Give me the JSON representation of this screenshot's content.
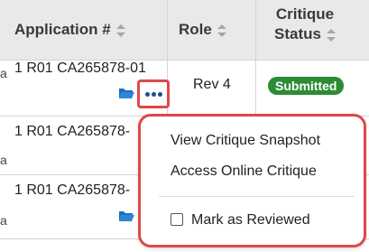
{
  "table": {
    "headers": {
      "application": "Application #",
      "role": "Role",
      "critique_status_line1": "Critique",
      "critique_status_line2": "Status"
    },
    "left_fragment": "a",
    "rows": [
      {
        "application": "1 R01 CA265878-01",
        "role": "Rev 4",
        "status": "Submitted"
      },
      {
        "application": "1 R01 CA265878-"
      },
      {
        "application": "1 R01 CA265878-"
      }
    ]
  },
  "status_color": "#2e8b35",
  "highlight_color": "#e04848",
  "menu": {
    "view_snapshot": "View Critique Snapshot",
    "access_online": "Access Online Critique",
    "mark_reviewed": "Mark as Reviewed"
  }
}
